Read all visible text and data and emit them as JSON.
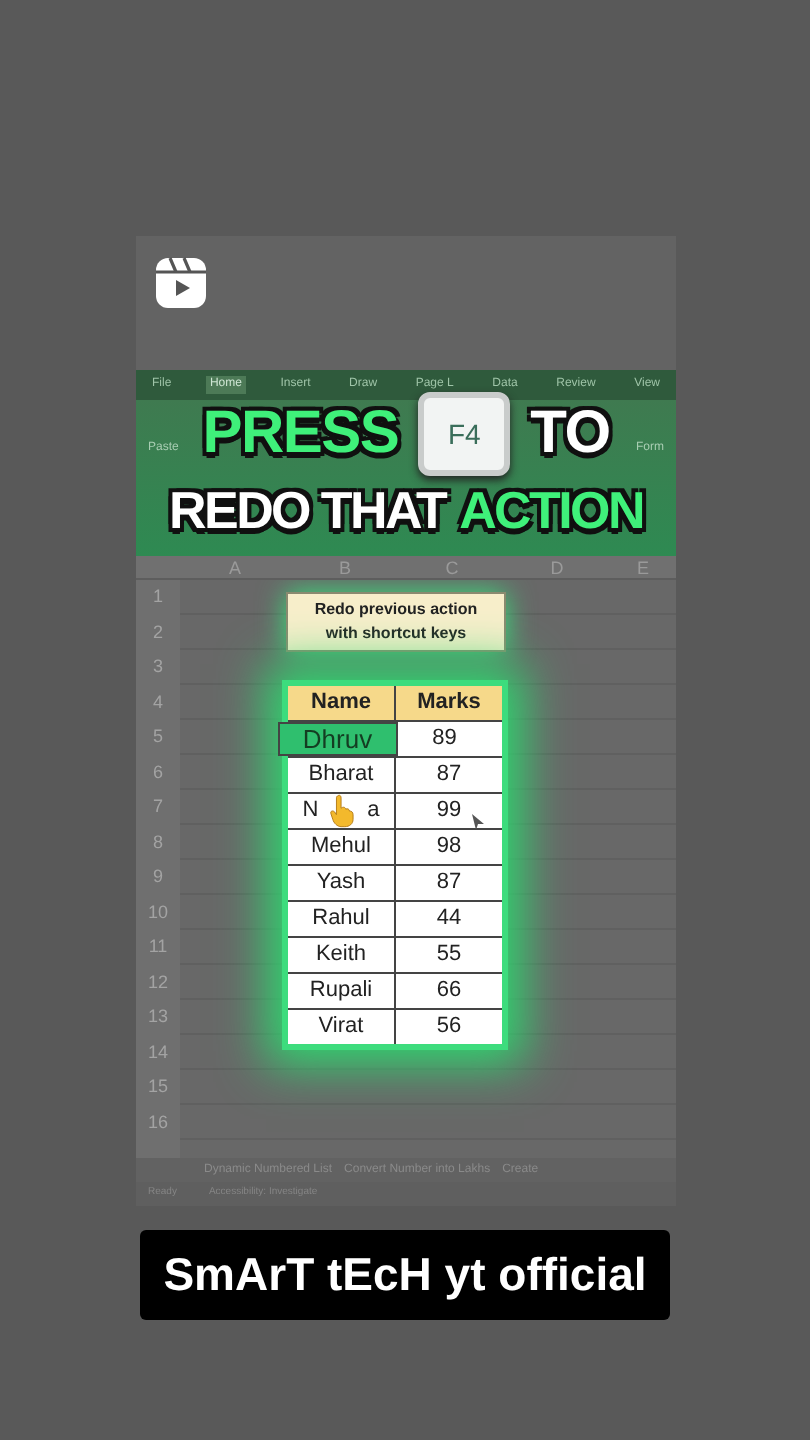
{
  "ribbon_tabs": [
    {
      "label": "File",
      "selected": false
    },
    {
      "label": "Home",
      "selected": true
    },
    {
      "label": "Insert",
      "selected": false
    },
    {
      "label": "Draw",
      "selected": false
    },
    {
      "label": "Page L",
      "selected": false
    },
    {
      "label": "Data",
      "selected": false
    },
    {
      "label": "Review",
      "selected": false
    },
    {
      "label": "View",
      "selected": false
    }
  ],
  "ribbon_buttons": [
    "Paste",
    "Form"
  ],
  "headline": {
    "line1_start": "PRESS",
    "key": "F4",
    "line1_end": "TO",
    "line2_start": "REDO THAT",
    "line2_highlight": "ACTION"
  },
  "columns": [
    "A",
    "B",
    "C",
    "D",
    "E"
  ],
  "row_numbers": [
    "1",
    "2",
    "3",
    "4",
    "5",
    "6",
    "7",
    "8",
    "9",
    "10",
    "11",
    "12",
    "13",
    "14",
    "15",
    "16"
  ],
  "callout": [
    "Redo previous action",
    "with shortcut keys"
  ],
  "table": {
    "columns": [
      "Name",
      "Marks"
    ],
    "rows": [
      {
        "name": "Dhruv",
        "marks": "89",
        "selected": true
      },
      {
        "name": "Bharat",
        "marks": "87",
        "selected": false
      },
      {
        "name": "N        a",
        "marks": "99",
        "selected": false
      },
      {
        "name": "Mehul",
        "marks": "98",
        "selected": false
      },
      {
        "name": "Yash",
        "marks": "87",
        "selected": false
      },
      {
        "name": "Rahul",
        "marks": "44",
        "selected": false
      },
      {
        "name": "Keith",
        "marks": "55",
        "selected": false
      },
      {
        "name": "Rupali",
        "marks": "66",
        "selected": false
      },
      {
        "name": "Virat",
        "marks": "56",
        "selected": false
      }
    ]
  },
  "sheet_tabs": [
    "Dynamic Numbered List",
    "Convert Number into Lakhs",
    "Create"
  ],
  "status_bar": [
    "Ready",
    "Accessibility: Investigate"
  ],
  "caption": "SmArT tEcH yt official"
}
